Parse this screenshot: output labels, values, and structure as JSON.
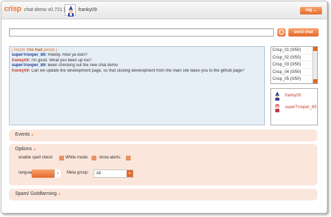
{
  "header": {
    "logo": "crisp",
    "version": "chat demo v0.721  |",
    "username": "franky09",
    "logout_label": "log ..."
  },
  "composer": {
    "message_value": "",
    "smiley_label": "☺",
    "send_label": "send chat"
  },
  "chat": {
    "room_prefix": "( Room ",
    "room_name": "The Hall",
    "room_suffix": " joined )",
    "messages": [
      {
        "nick": "superTrooper_89:",
        "text": " Howdy. How ya doin?"
      },
      {
        "nick": "franky09:",
        "text": " I'm good. What you been up too?"
      },
      {
        "nick": "superTrooper_89:",
        "text": " Been checking out the new chat demo"
      },
      {
        "nick": "franky09:",
        "text": " Can we update the development page, so that clicking development from the main site takes you to the github page?"
      }
    ]
  },
  "rooms": [
    "Crisp_01 (0/50)",
    "Crisp_02 (0/50)",
    "Crisp_03 (0/50)",
    "Crisp_04 (0/50)",
    "Crisp_05 (0/50)"
  ],
  "users": [
    "franky09",
    "superTrooper_89"
  ],
  "panels": {
    "events": "Events",
    "options": "Options",
    "spam": "Spam/ Goldfarming"
  },
  "options": {
    "spell_check": "enable spell check",
    "white_mode": "White mode:",
    "show_alerts": "show alerts:",
    "language_label": "language",
    "language_value": "",
    "meta_group_label": "Meta group:",
    "meta_group_value": "All"
  },
  "icons": {
    "expand": "▸",
    "collapse": "▴",
    "dropdown": "▾",
    "scroll_up": "▴",
    "scroll_down": "▾"
  },
  "colors": {
    "accent": "#e56b2c",
    "panel_bg": "#fbe6dc",
    "chat_bg": "#e6eef6",
    "nick_blue": "#1f3b92",
    "nick_red": "#c33a2a"
  }
}
